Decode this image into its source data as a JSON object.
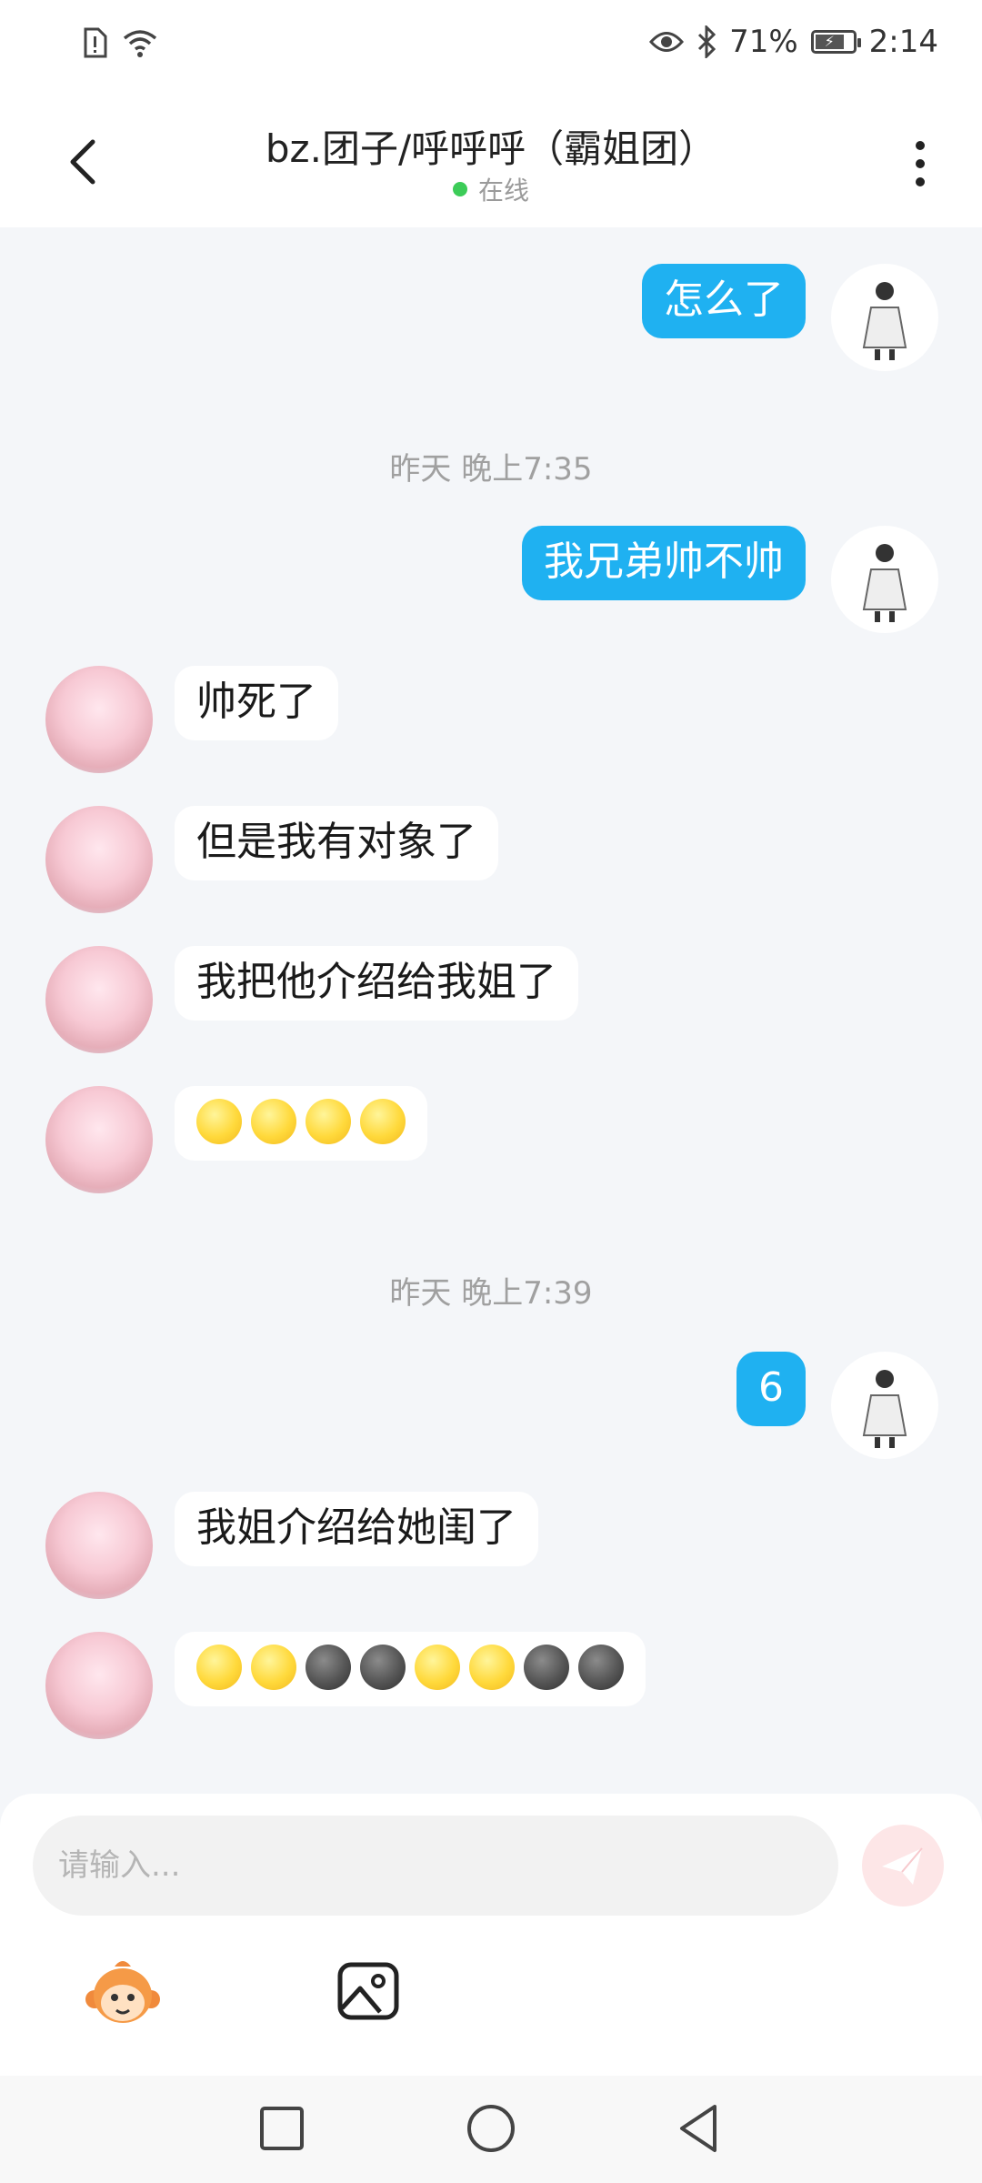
{
  "status_bar": {
    "battery": "71%",
    "battery_level": 0.71,
    "time": "2:14",
    "icons": [
      "sim-alert-icon",
      "wifi-icon",
      "eye-icon",
      "bluetooth-icon",
      "battery-icon"
    ]
  },
  "header": {
    "title": "bz.团子/呼呼呼（霸姐团）",
    "status": "在线",
    "status_color": "#3ccc58"
  },
  "messages": {
    "m1": "怎么了",
    "ts1": "昨天 晚上7:35",
    "m2": "我兄弟帅不帅",
    "m3": "帅死了",
    "m4": "但是我有对象了",
    "m5": "我把他介绍给我姐了",
    "m6_emojis": [
      "smirk",
      "smirk",
      "smirk",
      "smirk"
    ],
    "ts2": "昨天 晚上7:39",
    "m7": "6",
    "m8": "我姐介绍给她闺了",
    "m9_emojis": [
      "smirk",
      "smirk",
      "dark-moon",
      "dark-moon",
      "smirk",
      "smirk",
      "dark-moon",
      "dark-moon"
    ]
  },
  "input": {
    "placeholder": "请输入..."
  },
  "colors": {
    "outgoing_bubble": "#1fb1f1",
    "incoming_bubble": "#ffffff",
    "chat_background": "#f4f6f9",
    "send_button": "#fde6e7"
  }
}
